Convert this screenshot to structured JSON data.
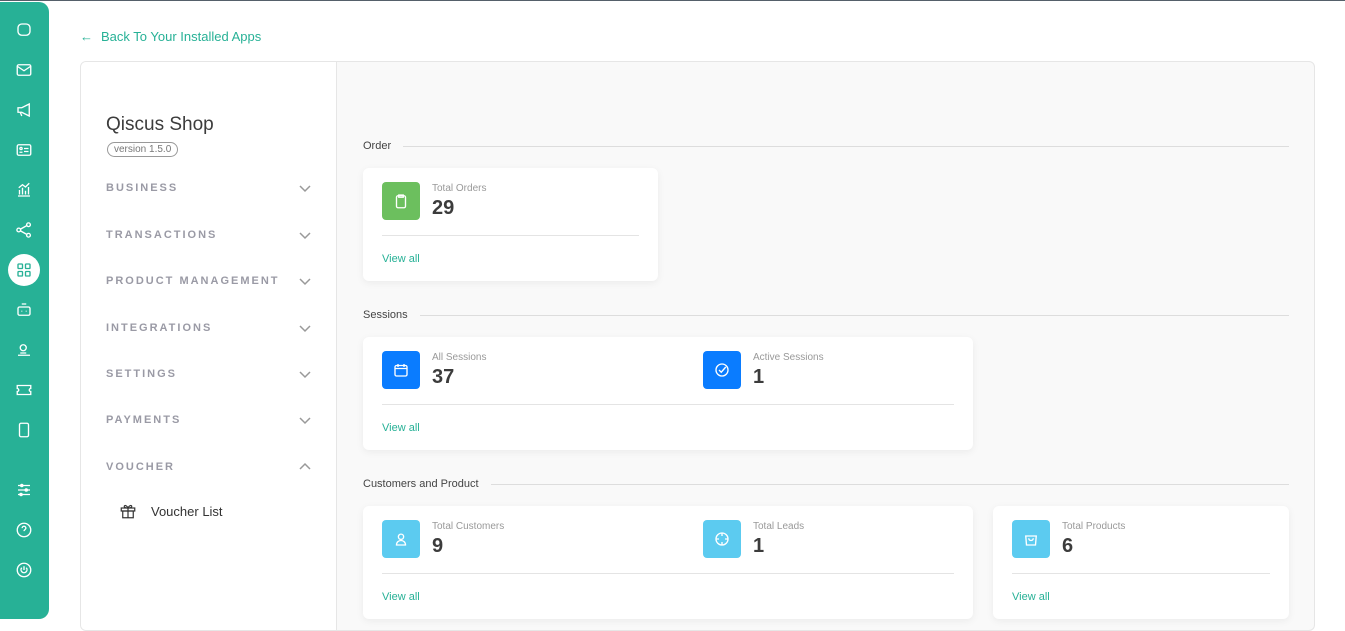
{
  "nav": {
    "back_label": "Back To Your Installed Apps"
  },
  "app": {
    "title": "Qiscus Shop",
    "version": "version 1.5.0"
  },
  "menu": [
    {
      "label": "BUSINESS"
    },
    {
      "label": "TRANSACTIONS"
    },
    {
      "label": "PRODUCT MANAGEMENT"
    },
    {
      "label": "INTEGRATIONS"
    },
    {
      "label": "SETTINGS"
    },
    {
      "label": "PAYMENTS"
    },
    {
      "label": "VOUCHER"
    }
  ],
  "voucher_sub": "Voucher List",
  "sections": {
    "order": "Order",
    "sessions": "Sessions",
    "customers": "Customers and Product"
  },
  "stats": {
    "orders": {
      "label": "Total Orders",
      "value": "29",
      "color": "#6cbf5e"
    },
    "all_sessions": {
      "label": "All Sessions",
      "value": "37",
      "color": "#0a7cff"
    },
    "active_sessions": {
      "label": "Active Sessions",
      "value": "1",
      "color": "#0a7cff"
    },
    "customers": {
      "label": "Total Customers",
      "value": "9",
      "color": "#5ccbf0"
    },
    "leads": {
      "label": "Total Leads",
      "value": "1",
      "color": "#5ccbf0"
    },
    "products": {
      "label": "Total Products",
      "value": "6",
      "color": "#5ccbf0"
    }
  },
  "view_all": "View all"
}
